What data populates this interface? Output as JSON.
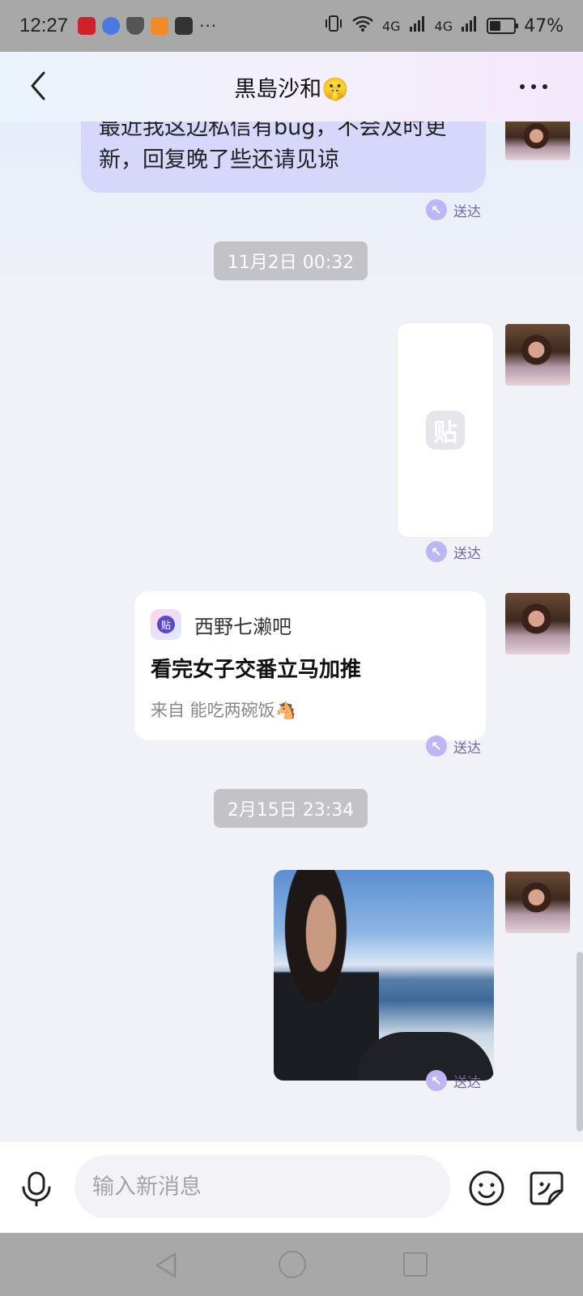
{
  "status_bar": {
    "time": "12:27",
    "network_1": "4G",
    "network_2": "4G",
    "battery_text": "47%",
    "battery_level": 0.47,
    "overflow": "···",
    "icons": [
      "app-red-icon",
      "music-icon",
      "shield-icon",
      "video-icon",
      "mail-icon",
      "vibrate-icon",
      "wifi-icon",
      "signal-icon",
      "battery-icon"
    ]
  },
  "header": {
    "title": "黒島沙和🤫"
  },
  "messages": {
    "text_msg": {
      "line1": "最近我这边私信有bug，不会及时更",
      "line2": "新，回复晚了些还请见谅"
    },
    "status_sent": "送达",
    "timestamp_1": "11月2日 00:32",
    "sticker_glyph": "贴",
    "post": {
      "logo_glyph": "贴",
      "forum": "西野七濑吧",
      "title": "看完女子交番立马加推",
      "source": "来自 能吃两碗饭🐴"
    },
    "timestamp_2": "2月15日 23:34"
  },
  "input": {
    "placeholder": "输入新消息"
  },
  "colors": {
    "bubble": "#d7d6fb",
    "accent": "#6e6aa8",
    "system_bar": "#a8a8a8"
  }
}
